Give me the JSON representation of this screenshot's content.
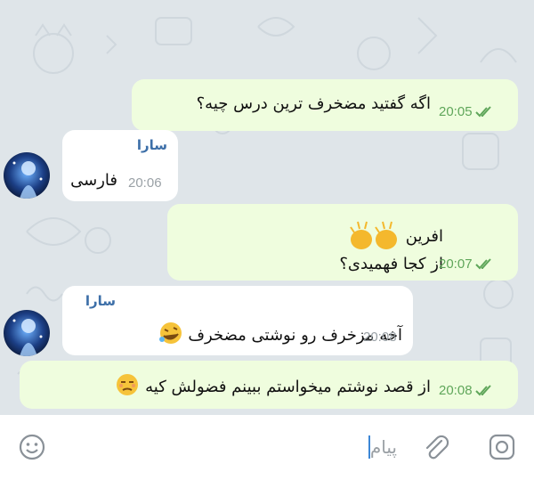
{
  "chat": {
    "messages": [
      {
        "direction": "out",
        "text": "اگه گفتید مضخرف ترین درس چیه؟",
        "time": "20:05",
        "read": true
      },
      {
        "direction": "in",
        "sender": "سارا",
        "text": "فارسی",
        "time": "20:06"
      },
      {
        "direction": "out",
        "line1": "افرین",
        "line2": "از کجا فهمیدی؟",
        "emoji": "clapping-hands",
        "time": "20:07",
        "read": true
      },
      {
        "direction": "in",
        "sender": "سارا",
        "text": "آخه مزخرف رو نوشتی مضخرف",
        "emoji": "rolling-laughing",
        "time": "20:08"
      },
      {
        "direction": "out",
        "text": "از قصد نوشتم میخواستم ببینم فضولش کیه",
        "emoji": "unamused-face",
        "time": "20:08",
        "read": true
      }
    ]
  },
  "input": {
    "placeholder": "پیام"
  },
  "icons": {
    "left": "emoji-icon",
    "attach": "attach-icon",
    "right": "camera-icon"
  },
  "colors": {
    "outgoing_bubble": "#effdde",
    "incoming_bubble": "#ffffff",
    "sender_name": "#3d6fa8",
    "check_marks": "#5fa65a"
  }
}
